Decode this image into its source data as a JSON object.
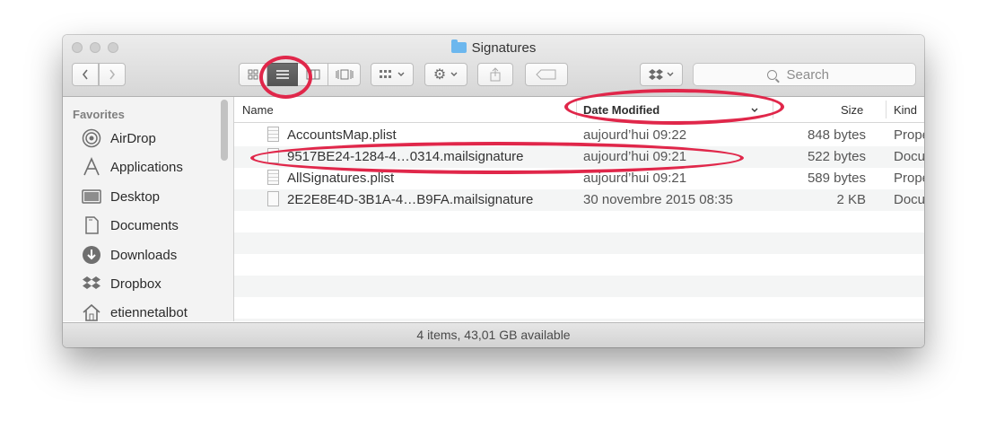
{
  "window": {
    "title": "Signatures",
    "status": "4 items, 43,01 GB available"
  },
  "toolbar": {
    "back_icon": "chevron-left-icon",
    "forward_icon": "chevron-right-icon",
    "view_modes": [
      "icon-view",
      "list-view",
      "column-view",
      "cover-flow-view"
    ],
    "active_view": "list-view",
    "search_placeholder": "Search",
    "dropbox_icon": "dropbox-icon"
  },
  "sidebar": {
    "heading": "Favorites",
    "items": [
      {
        "label": "AirDrop",
        "icon": "airdrop-icon"
      },
      {
        "label": "Applications",
        "icon": "applications-icon"
      },
      {
        "label": "Desktop",
        "icon": "desktop-icon"
      },
      {
        "label": "Documents",
        "icon": "documents-icon"
      },
      {
        "label": "Downloads",
        "icon": "downloads-icon"
      },
      {
        "label": "Dropbox",
        "icon": "dropbox-icon"
      },
      {
        "label": "etiennetalbot",
        "icon": "home-icon"
      }
    ]
  },
  "columns": {
    "name": "Name",
    "date": "Date Modified",
    "size": "Size",
    "kind": "Kind"
  },
  "files": [
    {
      "name": "AccountsMap.plist",
      "date": "aujourd’hui 09:22",
      "size": "848 bytes",
      "kind": "Prope"
    },
    {
      "name": "9517BE24-1284-4…0314.mailsignature",
      "date": "aujourd’hui 09:21",
      "size": "522 bytes",
      "kind": "Docu"
    },
    {
      "name": "AllSignatures.plist",
      "date": "aujourd’hui 09:21",
      "size": "589 bytes",
      "kind": "Prope"
    },
    {
      "name": "2E2E8E4D-3B1A-4…B9FA.mailsignature",
      "date": "30 novembre 2015 08:35",
      "size": "2 KB",
      "kind": "Docu"
    }
  ],
  "colors": {
    "annotation": "#e0274a",
    "folder": "#6cb7ee"
  }
}
